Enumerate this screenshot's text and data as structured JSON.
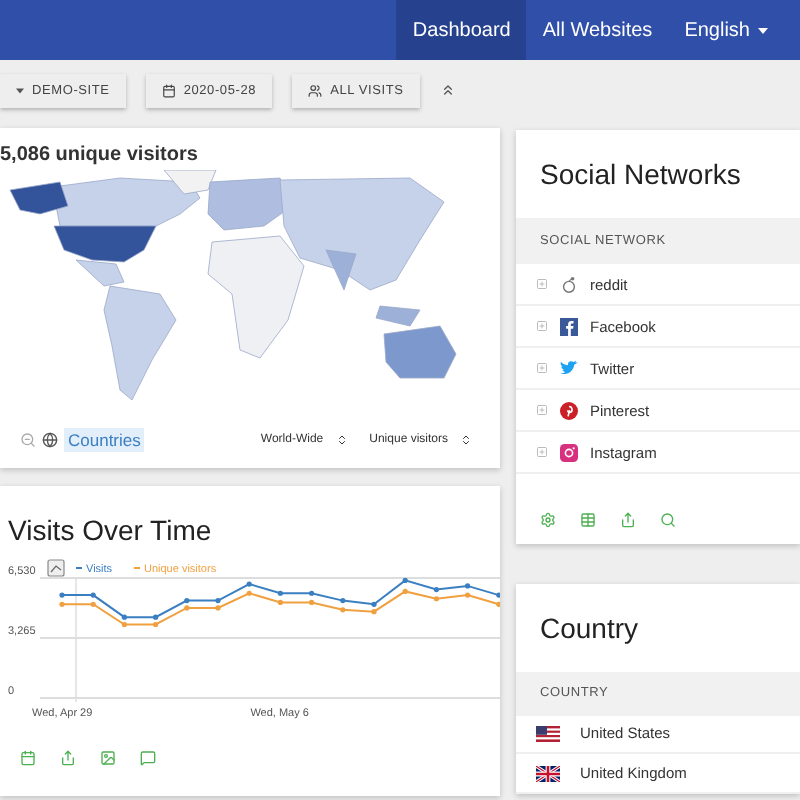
{
  "header": {
    "nav": [
      {
        "label": "Dashboard",
        "selected": true,
        "dropdown": false
      },
      {
        "label": "All Websites",
        "selected": false,
        "dropdown": false
      },
      {
        "label": "English",
        "selected": false,
        "dropdown": true
      }
    ]
  },
  "toolbar": {
    "site": "DEMO-SITE",
    "date": "2020-05-28",
    "segment": "ALL VISITS"
  },
  "map": {
    "title": "5,086 unique visitors",
    "link": "Countries",
    "region": "World-Wide",
    "metric": "Unique visitors"
  },
  "visits": {
    "title": "Visits Over Time",
    "chart_data": {
      "type": "line",
      "categories": [
        "Wed, Apr 29",
        null,
        null,
        null,
        null,
        null,
        null,
        "Wed, May 6",
        null,
        null,
        null,
        null,
        null,
        null,
        null
      ],
      "ylim": [
        0,
        6530
      ],
      "legend": "top",
      "ref_lines": [
        {
          "axis": "y",
          "value": 3265
        }
      ],
      "yticks": [
        0,
        {
          "value": 3265,
          "label": "3,265"
        },
        {
          "value": 6530,
          "label": "6,530"
        }
      ],
      "series": [
        {
          "name": "Visits",
          "color": "#3a7fc1",
          "values": [
            5600,
            5600,
            4400,
            4400,
            5300,
            5300,
            6200,
            5700,
            5700,
            5300,
            5100,
            6400,
            5900,
            6100,
            5600
          ]
        },
        {
          "name": "Unique visitors",
          "color": "#f0a040",
          "values": [
            5100,
            5100,
            4000,
            4000,
            4900,
            4900,
            5700,
            5200,
            5200,
            4800,
            4700,
            5800,
            5400,
            5600,
            5100
          ]
        }
      ]
    }
  },
  "social": {
    "title": "Social Networks",
    "column": "SOCIAL NETWORK",
    "rows": [
      {
        "name": "reddit",
        "kind": "reddit"
      },
      {
        "name": "Facebook",
        "kind": "facebook"
      },
      {
        "name": "Twitter",
        "kind": "twitter"
      },
      {
        "name": "Pinterest",
        "kind": "pinterest"
      },
      {
        "name": "Instagram",
        "kind": "instagram"
      }
    ]
  },
  "country": {
    "title": "Country",
    "column": "COUNTRY",
    "rows": [
      {
        "name": "United States",
        "kind": "us"
      },
      {
        "name": "United Kingdom",
        "kind": "uk"
      }
    ]
  }
}
